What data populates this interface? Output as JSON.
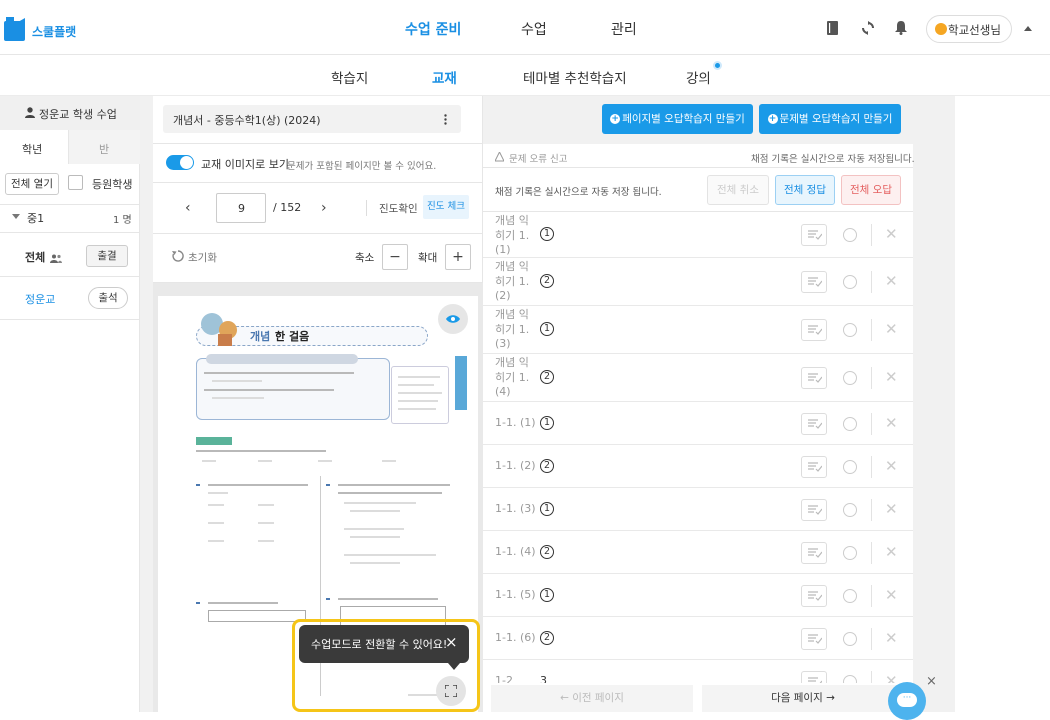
{
  "brand": {
    "name": "스쿨플랫",
    "color": "#1a8fe3"
  },
  "top_nav": {
    "items": [
      "수업 준비",
      "수업",
      "관리"
    ],
    "active": "수업 준비"
  },
  "user": {
    "name": "학교선생님"
  },
  "sub_nav": {
    "items": [
      "학습지",
      "교재",
      "테마별 추천학습지",
      "강의"
    ],
    "active": "교재"
  },
  "sidebar": {
    "class_title": "정운교 학생 수업",
    "tabs": [
      "학년",
      "반"
    ],
    "expand_all": "전체 열기",
    "enrolled_label": "등원학생",
    "group": {
      "name": "중1",
      "count": "1 명"
    },
    "all_row": {
      "label": "전체",
      "attendance_button": "출결"
    },
    "student": {
      "name": "정운교",
      "attendance_button": "출석"
    }
  },
  "book": {
    "title": "개념서 - 중등수학1(상) (2024)",
    "menu_icon": "more-vertical-icon",
    "toggle_label": "교재 이미지로 보기",
    "toggle_note": "문제가 포함된 페이지만 볼 수 있어요.",
    "page_current": "9",
    "page_total": "/ 152",
    "progress_label": "진도확인",
    "progress_check": "진도 체크",
    "reset_label": "초기화",
    "zoom_out_label": "축소",
    "zoom_in_label": "확대",
    "page_heading_a": "개념",
    "page_heading_b": "한 걸음",
    "tooltip": "수업모드로 전환할 수 있어요!"
  },
  "actions": {
    "page_wrong_sheet": "페이지별 오답학습지 만들기",
    "problem_wrong_sheet": "문제별 오답학습지 만들기"
  },
  "grading": {
    "report_error": "문제 오류 신고",
    "autosave_note_top": "채점 기록은 실시간으로 자동 저장됩니다.",
    "autosave_note": "채점 기록은 실시간으로 자동 저장 됩니다.",
    "cancel_all": "전체 취소",
    "all_correct": "전체 정답",
    "all_wrong": "전체 오답",
    "rows": [
      {
        "label": "개념 익히기 1. (1)",
        "answer": "1"
      },
      {
        "label": "개념 익히기 1. (2)",
        "answer": "2"
      },
      {
        "label": "개념 익히기 1. (3)",
        "answer": "1"
      },
      {
        "label": "개념 익히기 1. (4)",
        "answer": "2"
      },
      {
        "label": "1-1. (1)",
        "answer": "1"
      },
      {
        "label": "1-1. (2)",
        "answer": "2"
      },
      {
        "label": "1-1. (3)",
        "answer": "1"
      },
      {
        "label": "1-1. (4)",
        "answer": "2"
      },
      {
        "label": "1-1. (5)",
        "answer": "1"
      },
      {
        "label": "1-1. (6)",
        "answer": "2"
      },
      {
        "label": "1-2",
        "answer": "3"
      }
    ],
    "prev_page": "← 이전 페이지",
    "next_page": "다음 페이지 →"
  },
  "colors": {
    "accent": "#1a9ae8",
    "highlight": "#f5c518",
    "tooltip_bg": "#3a3a3a"
  }
}
